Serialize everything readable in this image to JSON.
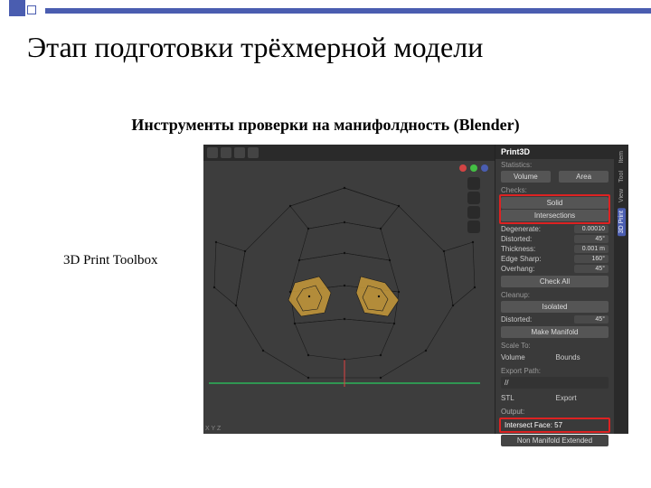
{
  "slide": {
    "title": "Этап подготовки трёхмерной модели",
    "subtitle": "Инструменты проверки на манифолдность (Blender)",
    "left_label": "3D Print Toolbox"
  },
  "panel": {
    "header": "Print3D",
    "statistics_label": "Statistics:",
    "volume": "Volume",
    "area": "Area",
    "checks_label": "Checks:",
    "solid": "Solid",
    "intersections": "Intersections",
    "degenerate": {
      "label": "Degenerate:",
      "value": "0.00010"
    },
    "distorted": {
      "label": "Distorted:",
      "value": "45°"
    },
    "thickness": {
      "label": "Thickness:",
      "value": "0.001 m"
    },
    "edge_sharp": {
      "label": "Edge Sharp:",
      "value": "160°"
    },
    "overhang": {
      "label": "Overhang:",
      "value": "45°"
    },
    "check_all": "Check All",
    "cleanup_label": "Cleanup:",
    "isolated": "Isolated",
    "distorted2": {
      "label": "Distorted:",
      "value": "45°"
    },
    "make_manifold": "Make Manifold",
    "scale_to_label": "Scale To:",
    "scale_volume": "Volume",
    "scale_bounds": "Bounds",
    "export_label": "Export Path:",
    "export_path": "//",
    "format": "STL",
    "export_btn": "Export",
    "output_label": "Output:",
    "result": "Intersect Face: 57",
    "nonmanifold": "Non Manifold Extended"
  },
  "vtabs": {
    "item": "Item",
    "tool": "Tool",
    "view": "View",
    "print": "3D Print"
  },
  "gizmo": {
    "x": "#d24444",
    "y": "#44c044",
    "z": "#4a5db0"
  }
}
